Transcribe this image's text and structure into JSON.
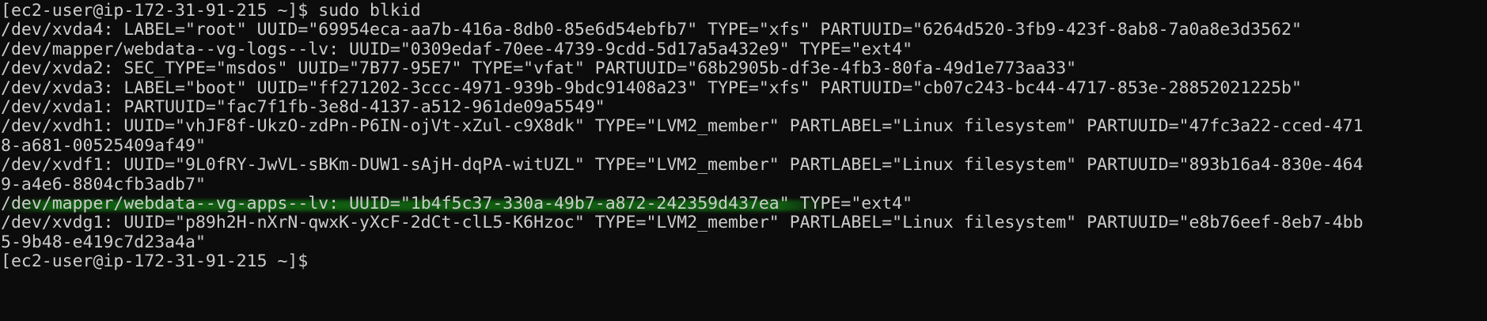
{
  "terminal": {
    "lines": [
      "[ec2-user@ip-172-31-91-215 ~]$ sudo blkid",
      "/dev/xvda4: LABEL=\"root\" UUID=\"69954eca-aa7b-416a-8db0-85e6d54ebfb7\" TYPE=\"xfs\" PARTUUID=\"6264d520-3fb9-423f-8ab8-7a0a8e3d3562\"",
      "/dev/mapper/webdata--vg-logs--lv: UUID=\"0309edaf-70ee-4739-9cdd-5d17a5a432e9\" TYPE=\"ext4\"",
      "/dev/xvda2: SEC_TYPE=\"msdos\" UUID=\"7B77-95E7\" TYPE=\"vfat\" PARTUUID=\"68b2905b-df3e-4fb3-80fa-49d1e773aa33\"",
      "/dev/xvda3: LABEL=\"boot\" UUID=\"ff271202-3ccc-4971-939b-9bdc91408a23\" TYPE=\"xfs\" PARTUUID=\"cb07c243-bc44-4717-853e-28852021225b\"",
      "/dev/xvda1: PARTUUID=\"fac7f1fb-3e8d-4137-a512-961de09a5549\"",
      "/dev/xvdh1: UUID=\"vhJF8f-UkzO-zdPn-P6IN-ojVt-xZul-c9X8dk\" TYPE=\"LVM2_member\" PARTLABEL=\"Linux filesystem\" PARTUUID=\"47fc3a22-cced-471",
      "8-a681-00525409af49\"",
      "/dev/xvdf1: UUID=\"9L0fRY-JwVL-sBKm-DUW1-sAjH-dqPA-witUZL\" TYPE=\"LVM2_member\" PARTLABEL=\"Linux filesystem\" PARTUUID=\"893b16a4-830e-464",
      "9-a4e6-8804cfb3adb7\"",
      "/dev/mapper/webdata--vg-apps--lv: UUID=\"1b4f5c37-330a-49b7-a872-242359d437ea\" TYPE=\"ext4\"",
      "/dev/xvdg1: UUID=\"p89h2H-nXrN-qwxK-yXcF-2dCt-clL5-K6Hzoc\" TYPE=\"LVM2_member\" PARTLABEL=\"Linux filesystem\" PARTUUID=\"e8b76eef-8eb7-4bb",
      "5-9b48-e419c7d23a4a\"",
      "[ec2-user@ip-172-31-91-215 ~]$"
    ],
    "highlight_color": "#16a016",
    "text_color": "#cccccc",
    "background_color": "#0c0c0c"
  }
}
